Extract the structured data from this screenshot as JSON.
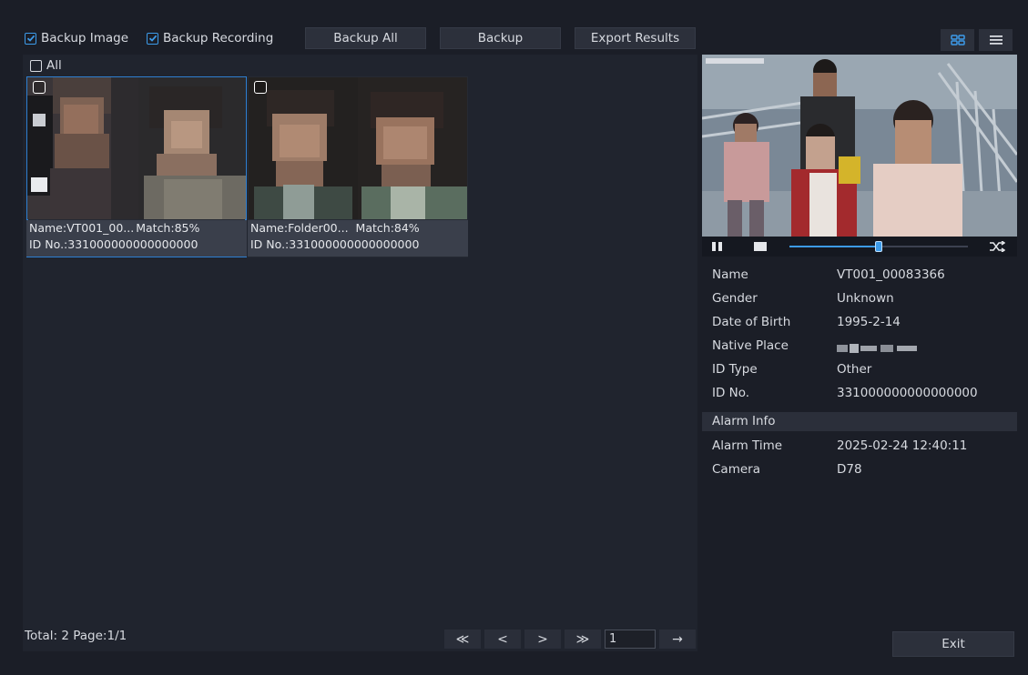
{
  "toolbar": {
    "backup_image": "Backup Image",
    "backup_recording": "Backup Recording",
    "backup_all": "Backup All",
    "backup": "Backup",
    "export_results": "Export Results"
  },
  "select_all_label": "All",
  "results": [
    {
      "name": "Name:VT001_00...",
      "match": "Match:85%",
      "id_no": "ID No.:331000000000000000",
      "selected": true
    },
    {
      "name": "Name:Folder00...",
      "match": "Match:84%",
      "id_no": "ID No.:331000000000000000",
      "selected": false
    }
  ],
  "footer": {
    "status": "Total: 2  Page:1/1",
    "first": "≪",
    "prev": "<",
    "next": ">",
    "last": "≫",
    "page_input": "1",
    "go": "→"
  },
  "details": {
    "name_label": "Name",
    "name_value": "VT001_00083366",
    "gender_label": "Gender",
    "gender_value": "Unknown",
    "dob_label": "Date of Birth",
    "dob_value": "1995-2-14",
    "native_label": "Native Place",
    "idtype_label": "ID Type",
    "idtype_value": "Other",
    "idno_label": "ID No.",
    "idno_value": "331000000000000000"
  },
  "alarm": {
    "header": "Alarm Info",
    "time_label": "Alarm Time",
    "time_value": "2025-02-24 12:40:11",
    "camera_label": "Camera",
    "camera_value": "D78"
  },
  "video_progress": 0.5,
  "exit_label": "Exit",
  "colors": {
    "accent": "#3d9be9",
    "background": "#1b1e27",
    "panel": "#20242e",
    "button": "#2c303b"
  }
}
